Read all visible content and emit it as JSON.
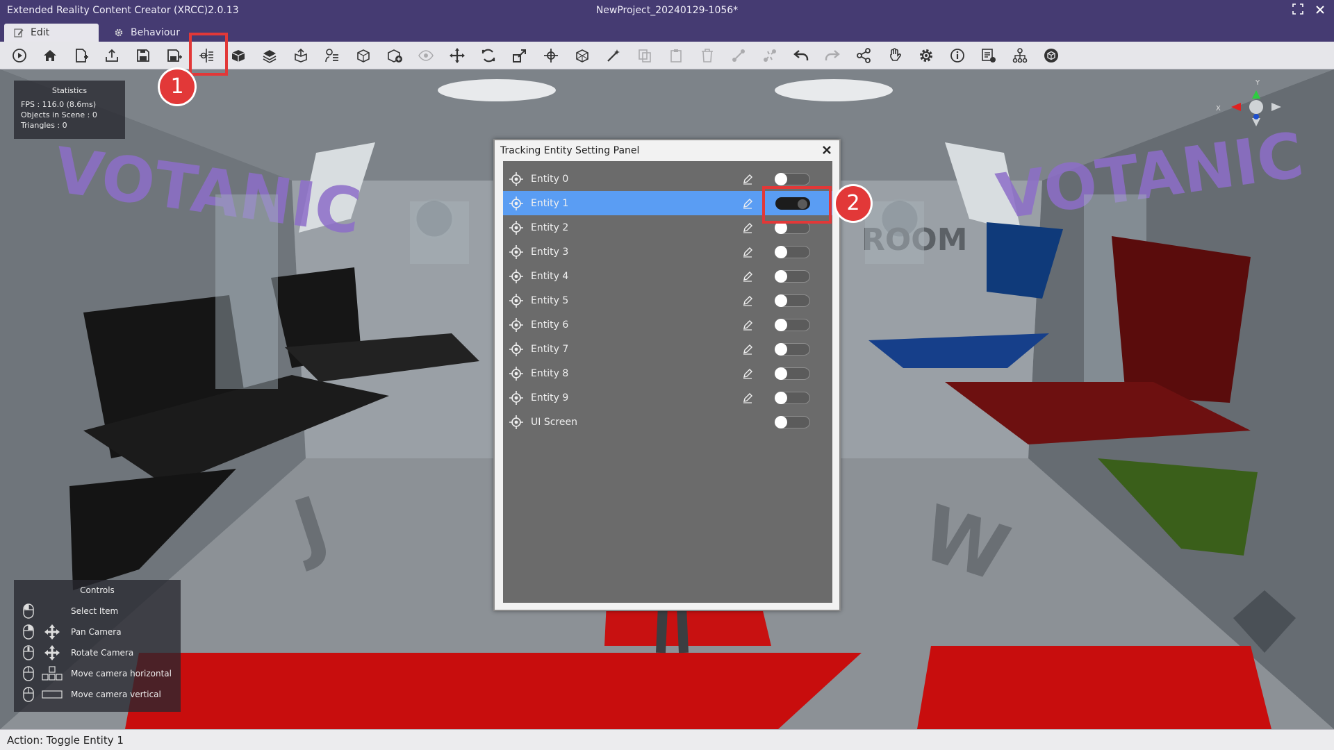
{
  "window": {
    "app_title": "Extended Reality Content Creator (XRCC)2.0.13",
    "project_title": "NewProject_20240129-1056*",
    "maximize_icon": "maximize-icon",
    "close_icon": "close-icon"
  },
  "tabs": [
    {
      "label": "Edit",
      "icon": "edit-icon",
      "active": true
    },
    {
      "label": "Behaviour",
      "icon": "gear-icon",
      "active": false
    }
  ],
  "toolbar": {
    "buttons": [
      {
        "name": "play",
        "enabled": true
      },
      {
        "name": "home",
        "enabled": true
      },
      {
        "name": "new-project",
        "enabled": true
      },
      {
        "name": "open-project",
        "enabled": true
      },
      {
        "name": "save",
        "enabled": true
      },
      {
        "name": "save-as",
        "enabled": true
      },
      {
        "name": "tracking-entity-settings",
        "enabled": true
      },
      {
        "name": "import-model",
        "enabled": true
      },
      {
        "name": "layers",
        "enabled": true
      },
      {
        "name": "export",
        "enabled": true
      },
      {
        "name": "scene-settings",
        "enabled": true
      },
      {
        "name": "cube-outline",
        "enabled": true
      },
      {
        "name": "add-object",
        "enabled": true
      },
      {
        "name": "visibility",
        "enabled": false
      },
      {
        "name": "move",
        "enabled": true
      },
      {
        "name": "rotate",
        "enabled": true
      },
      {
        "name": "scale",
        "enabled": true
      },
      {
        "name": "pivot",
        "enabled": true
      },
      {
        "name": "mesh",
        "enabled": true
      },
      {
        "name": "pick-tool",
        "enabled": true
      },
      {
        "name": "copy",
        "enabled": false
      },
      {
        "name": "paste",
        "enabled": false
      },
      {
        "name": "delete",
        "enabled": false
      },
      {
        "name": "link",
        "enabled": false
      },
      {
        "name": "unlink",
        "enabled": false
      },
      {
        "name": "undo",
        "enabled": true
      },
      {
        "name": "redo",
        "enabled": false
      },
      {
        "name": "share",
        "enabled": true
      },
      {
        "name": "hand-gesture",
        "enabled": true
      },
      {
        "name": "settings",
        "enabled": true
      },
      {
        "name": "info",
        "enabled": true
      },
      {
        "name": "report",
        "enabled": true
      },
      {
        "name": "hierarchy",
        "enabled": true
      },
      {
        "name": "package",
        "enabled": true
      }
    ]
  },
  "statistics": {
    "title": "Statistics",
    "fps": "FPS : 116.0 (8.6ms)",
    "objects": "Objects in Scene : 0",
    "triangles": "Triangles : 0"
  },
  "controls": {
    "title": "Controls",
    "items": [
      {
        "label": "Select Item",
        "extra_icon": ""
      },
      {
        "label": "Pan Camera",
        "extra_icon": "move-arrows-icon"
      },
      {
        "label": "Rotate Camera",
        "extra_icon": "move-arrows-icon"
      },
      {
        "label": "Move camera horizontal",
        "extra_icon": "wasd-keys-icon"
      },
      {
        "label": "Move camera vertical",
        "extra_icon": "spacebar-icon"
      }
    ]
  },
  "gizmo": {
    "x_label": "X",
    "y_label": "Y"
  },
  "scene": {
    "wall_text_left": "VOTANIC",
    "wall_text_right": "VOTANIC",
    "room_text": "ROOM"
  },
  "panel": {
    "title": "Tracking Entity Setting Panel",
    "entities": [
      {
        "label": "Entity 0",
        "selected": false,
        "enabled": false,
        "editable": true
      },
      {
        "label": "Entity 1",
        "selected": true,
        "enabled": true,
        "editable": true
      },
      {
        "label": "Entity 2",
        "selected": false,
        "enabled": false,
        "editable": true
      },
      {
        "label": "Entity 3",
        "selected": false,
        "enabled": false,
        "editable": true
      },
      {
        "label": "Entity 4",
        "selected": false,
        "enabled": false,
        "editable": true
      },
      {
        "label": "Entity 5",
        "selected": false,
        "enabled": false,
        "editable": true
      },
      {
        "label": "Entity 6",
        "selected": false,
        "enabled": false,
        "editable": true
      },
      {
        "label": "Entity 7",
        "selected": false,
        "enabled": false,
        "editable": true
      },
      {
        "label": "Entity 8",
        "selected": false,
        "enabled": false,
        "editable": true
      },
      {
        "label": "Entity 9",
        "selected": false,
        "enabled": false,
        "editable": true
      },
      {
        "label": "UI Screen",
        "selected": false,
        "enabled": false,
        "editable": false
      }
    ]
  },
  "annotations": [
    {
      "label": "1"
    },
    {
      "label": "2"
    }
  ],
  "status": {
    "text": "Action: Toggle Entity 1"
  },
  "colors": {
    "title_bar": "#453b72",
    "selection": "#5a9df3",
    "annotation_red": "#e23838",
    "toggle_on": "#1c1c1c"
  }
}
